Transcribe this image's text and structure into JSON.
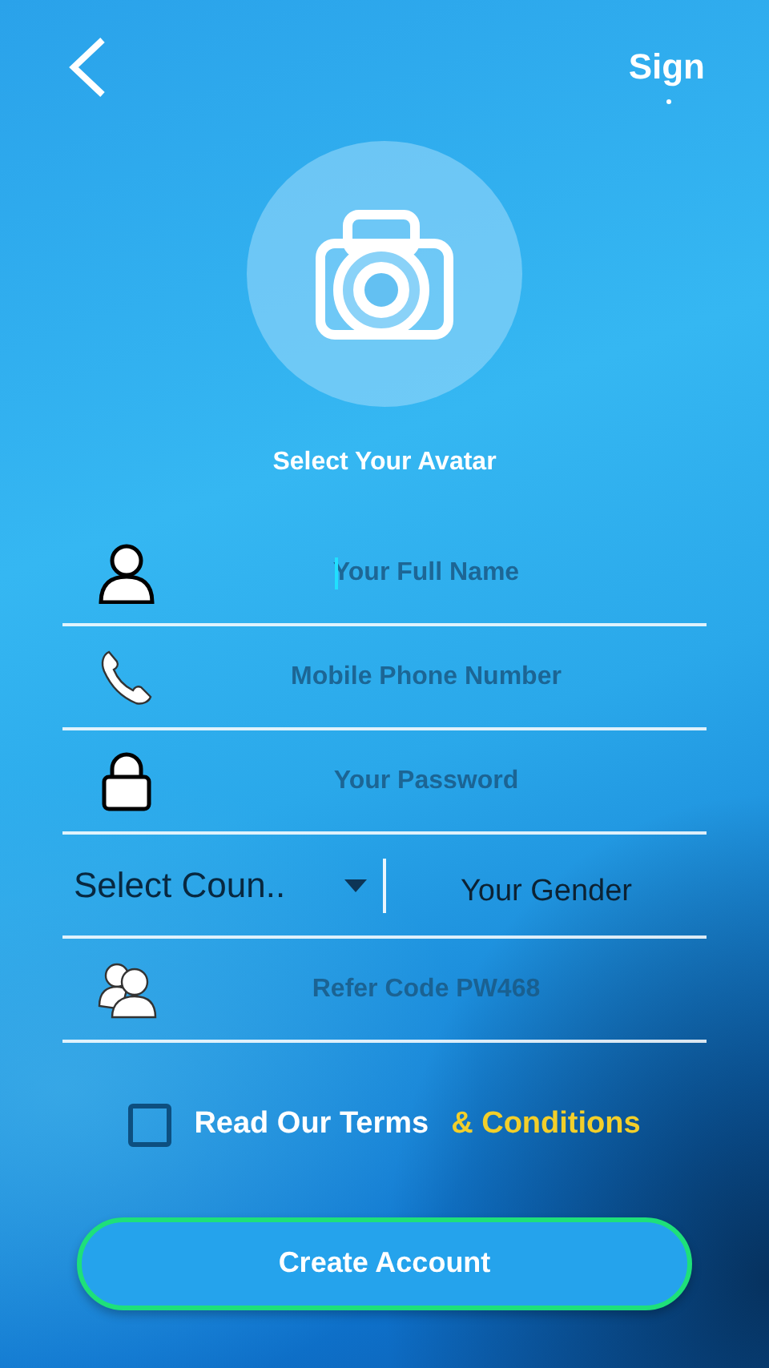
{
  "header": {
    "action": "Sign"
  },
  "avatar": {
    "label": "Select Your Avatar"
  },
  "fields": [
    {
      "kind": "input",
      "placeholder": "Your Full Name",
      "focused": true
    },
    {
      "kind": "input",
      "placeholder": "Mobile Phone Number",
      "focused": false
    },
    {
      "kind": "input",
      "placeholder": "Your Password",
      "focused": false
    },
    {
      "kind": "pair",
      "country": "Select Coun..",
      "gender": "Your Gender"
    },
    {
      "kind": "input",
      "placeholder": "Refer Code PW468",
      "focused": false
    }
  ],
  "terms": {
    "checked": false,
    "text": "Read Our Terms",
    "link": "& Conditions"
  },
  "submit": "Create Account"
}
